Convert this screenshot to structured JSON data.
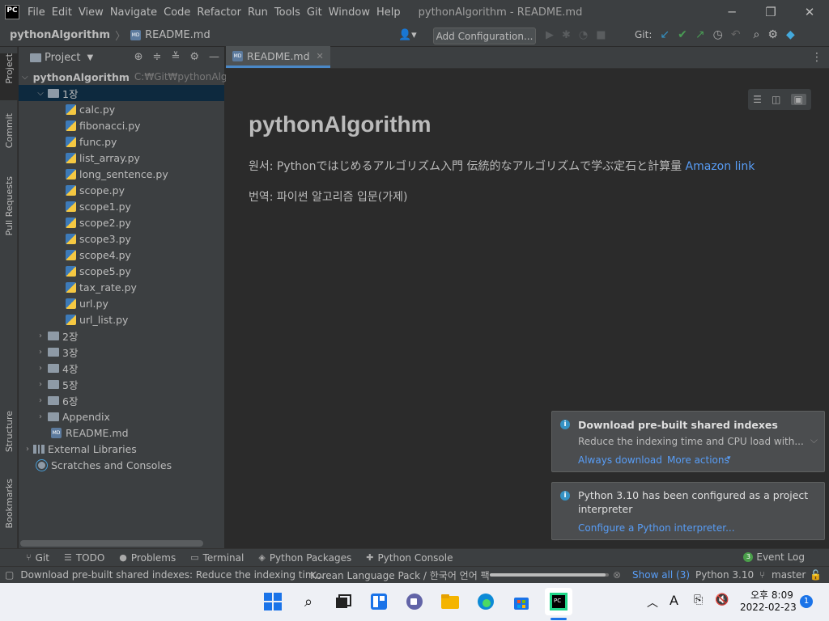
{
  "titlebar": {
    "logo": "PC",
    "menus": [
      "File",
      "Edit",
      "View",
      "Navigate",
      "Code",
      "Refactor",
      "Run",
      "Tools",
      "Git",
      "Window",
      "Help"
    ],
    "title": "pythonAlgorithm - README.md",
    "minimize": "─",
    "restore": "❐",
    "close": "✕"
  },
  "navbar": {
    "project": "pythonAlgorithm",
    "file": "README.md",
    "add_configuration": "Add Configuration...",
    "git_label": "Git:"
  },
  "left_tabs": [
    "Project",
    "Commit",
    "Pull Requests",
    "Structure",
    "Bookmarks"
  ],
  "project_panel": {
    "title": "Project",
    "root": {
      "name": "pythonAlgorithm",
      "path": "C:₩Git₩pythonAlgor"
    },
    "open_folder": "1장",
    "files": [
      "calc.py",
      "fibonacci.py",
      "func.py",
      "list_array.py",
      "long_sentence.py",
      "scope.py",
      "scope1.py",
      "scope2.py",
      "scope3.py",
      "scope4.py",
      "scope5.py",
      "tax_rate.py",
      "url.py",
      "url_list.py"
    ],
    "folders": [
      "2장",
      "3장",
      "4장",
      "5장",
      "6장",
      "Appendix"
    ],
    "readme": "README.md",
    "external_libraries": "External Libraries",
    "scratches": "Scratches and Consoles"
  },
  "editor": {
    "tab": "README.md",
    "md_title": "pythonAlgorithm",
    "line1_prefix": "원서: Pythonではじめるアルゴリズム入門 伝統的なアルゴリズムで学ぶ定石と計算量",
    "line1_link": "Amazon link",
    "line2": "번역: 파이썬 알고리즘 입문(가제)"
  },
  "notifications": [
    {
      "title": "Download pre-built shared indexes",
      "body": "Reduce the indexing time and CPU load with...",
      "link1": "Always download",
      "link2": "More actions"
    },
    {
      "title": "Python 3.10 has been configured as a project",
      "title2": "interpreter",
      "link1": "Configure a Python interpreter..."
    }
  ],
  "bottom_tools": [
    "Git",
    "TODO",
    "Problems",
    "Terminal",
    "Python Packages",
    "Python Console"
  ],
  "event_log": {
    "label": "Event Log",
    "count": "3"
  },
  "statusbar": {
    "message": "Download pre-built shared indexes: Reduce the indexing tim...",
    "task": "Korean Language Pack / 한국어 언어 팩",
    "progress": 0.97,
    "show_all": "Show all (3)",
    "interpreter": "Python 3.10",
    "branch": "master"
  },
  "taskbar": {
    "time": "오후 8:09",
    "date": "2022-02-23",
    "ime": "A",
    "notif_count": "1"
  }
}
